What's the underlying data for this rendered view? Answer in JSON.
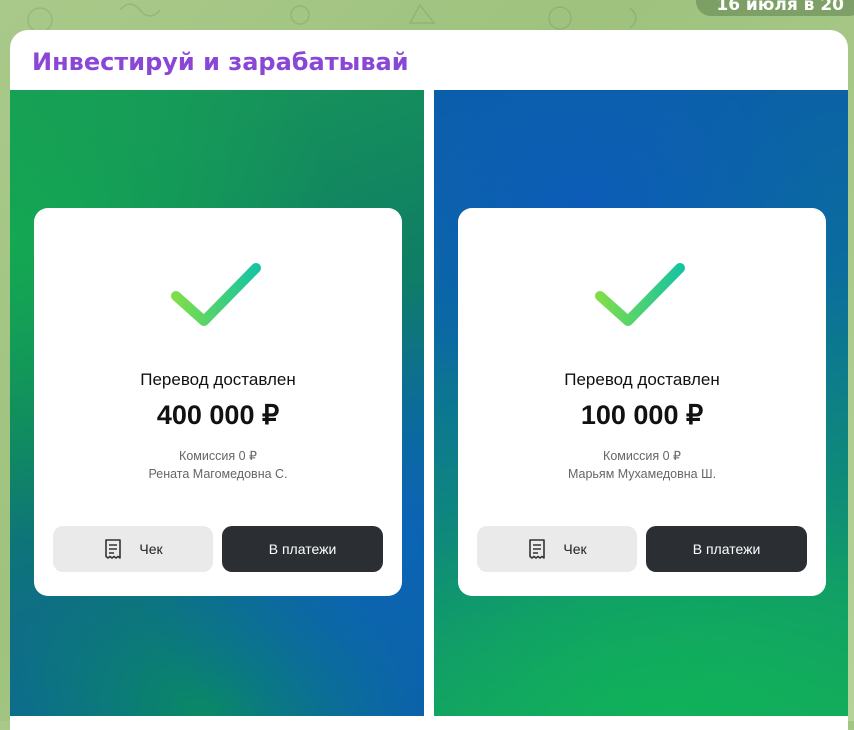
{
  "top_pill": {
    "date_text": "16 июля в 20"
  },
  "message": {
    "channel_name": "Инвестируй и зарабатывай"
  },
  "cards": [
    {
      "title": "Перевод доставлен",
      "amount": "400 000 ₽",
      "fee": "Комиссия 0 ₽",
      "recipient": "Рената Магомедовна С.",
      "receipt_label": "Чек",
      "payments_label": "В платежи"
    },
    {
      "title": "Перевод доставлен",
      "amount": "100 000 ₽",
      "fee": "Комиссия 0 ₽",
      "recipient": "Марьям Мухамедовна Ш.",
      "receipt_label": "Чек",
      "payments_label": "В платежи"
    }
  ],
  "colors": {
    "channel_name": "#8a47d6",
    "check_start": "#7ede4a",
    "check_end": "#18c4a0",
    "dark_button": "#2b2f33"
  },
  "icons": {
    "check": "checkmark-icon",
    "receipt": "receipt-icon"
  }
}
